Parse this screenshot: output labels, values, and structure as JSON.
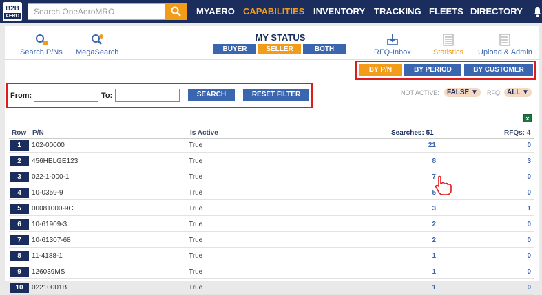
{
  "header": {
    "logo_text": "B2B",
    "logo_sub": "AERO",
    "search_placeholder": "Search OneAeroMRO",
    "nav": [
      "MYAERO",
      "CAPABILITIES",
      "INVENTORY",
      "TRACKING",
      "FLEETS",
      "DIRECTORY"
    ],
    "active_nav": "CAPABILITIES"
  },
  "tools": {
    "search_pns": "Search P/Ns",
    "megasearch": "MegaSearch",
    "rfq_inbox": "RFQ-Inbox",
    "statistics": "Statistics",
    "upload_admin": "Upload & Admin"
  },
  "status": {
    "title": "MY STATUS",
    "tabs": [
      "BUYER",
      "SELLER",
      "BOTH"
    ],
    "active": "SELLER"
  },
  "views": {
    "buttons": [
      "BY P/N",
      "BY PERIOD",
      "BY CUSTOMER"
    ],
    "active": "BY P/N"
  },
  "filters": {
    "from_label": "From:",
    "to_label": "To:",
    "from_value": "",
    "to_value": "",
    "search_btn": "SEARCH",
    "reset_btn": "RESET FILTER",
    "not_active_label": "NOT ACTIVE:",
    "not_active_value": "FALSE ▼",
    "rfq_label": "RFQ:",
    "rfq_value": "ALL ▼"
  },
  "table": {
    "headers": {
      "row": "Row",
      "pn": "P/N",
      "is_active": "Is Active",
      "searches": "Searches: 51",
      "rfqs": "RFQs: 4"
    },
    "rows": [
      {
        "row": "1",
        "pn": "102-00000",
        "active": "True",
        "searches": "21",
        "rfqs": "0"
      },
      {
        "row": "2",
        "pn": "456HELGE123",
        "active": "True",
        "searches": "8",
        "rfqs": "3"
      },
      {
        "row": "3",
        "pn": "022-1-000-1",
        "active": "True",
        "searches": "7",
        "rfqs": "0"
      },
      {
        "row": "4",
        "pn": "10-0359-9",
        "active": "True",
        "searches": "5",
        "rfqs": "0"
      },
      {
        "row": "5",
        "pn": "00081000-9C",
        "active": "True",
        "searches": "3",
        "rfqs": "1"
      },
      {
        "row": "6",
        "pn": "10-61909-3",
        "active": "True",
        "searches": "2",
        "rfqs": "0"
      },
      {
        "row": "7",
        "pn": "10-61307-68",
        "active": "True",
        "searches": "2",
        "rfqs": "0"
      },
      {
        "row": "8",
        "pn": "11-4188-1",
        "active": "True",
        "searches": "1",
        "rfqs": "0"
      },
      {
        "row": "9",
        "pn": "126039MS",
        "active": "True",
        "searches": "1",
        "rfqs": "0"
      },
      {
        "row": "10",
        "pn": "02210001B",
        "active": "True",
        "searches": "1",
        "rfqs": "0"
      }
    ]
  },
  "colors": {
    "navy": "#1a2d5c",
    "orange": "#f39c1a",
    "blue": "#3a66b0",
    "highlight": "#e01b1b"
  }
}
